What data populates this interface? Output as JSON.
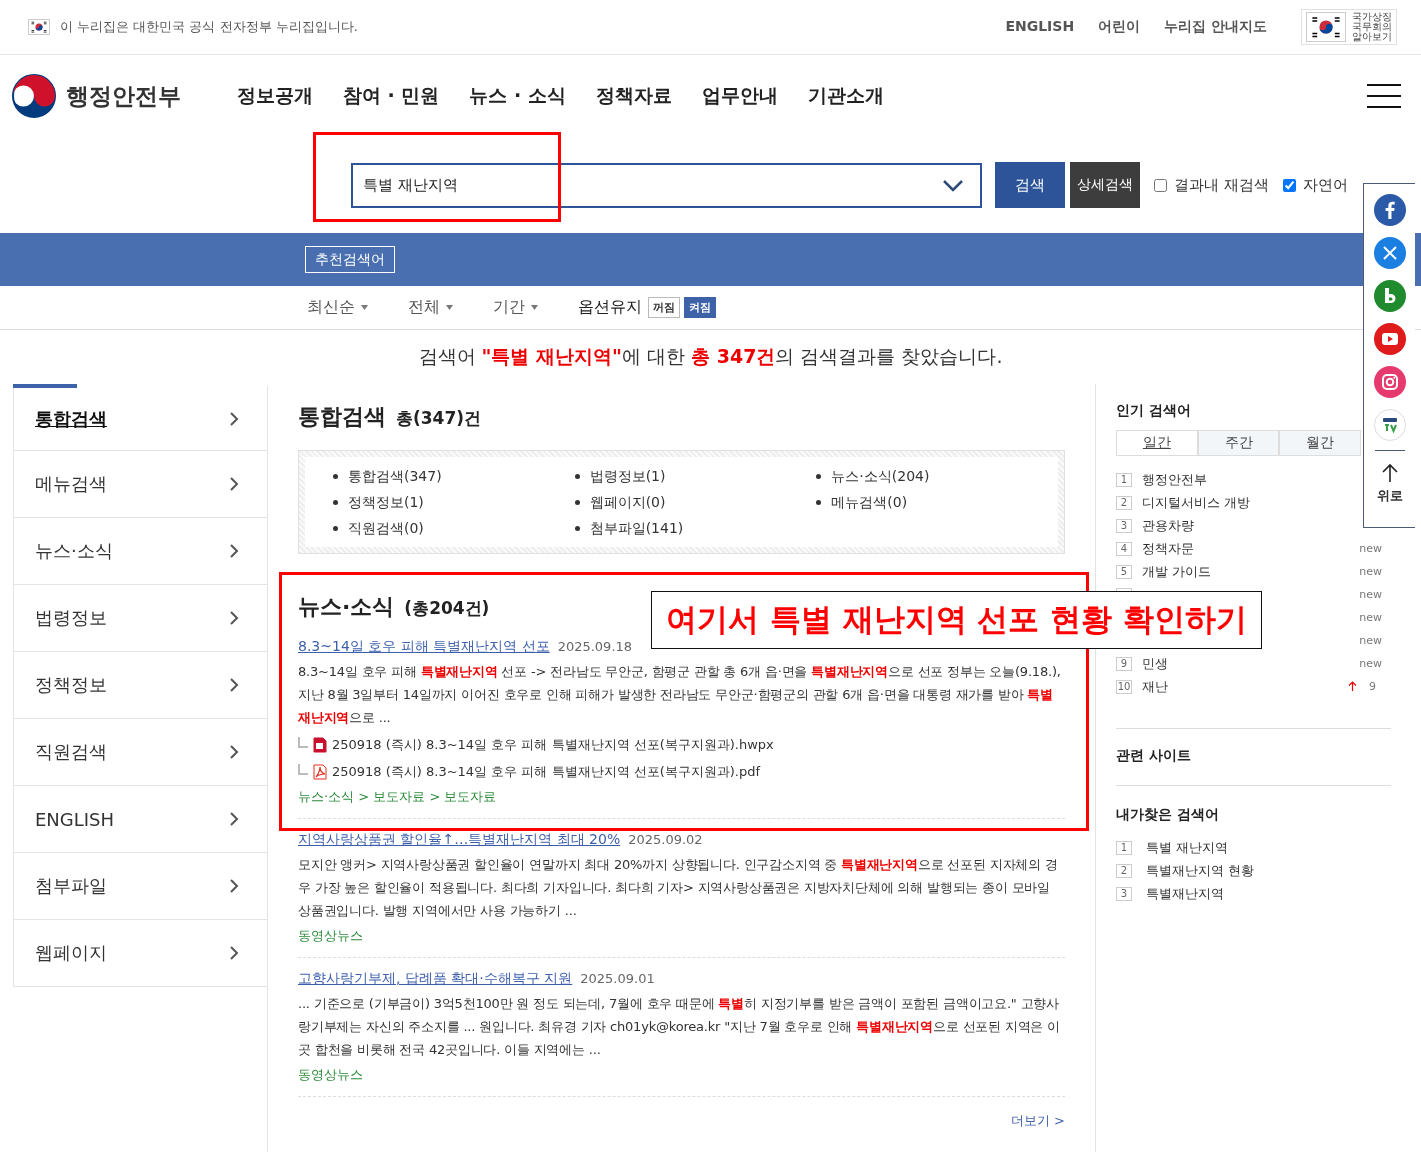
{
  "gov_banner": {
    "text": "이 누리집은 대한민국 공식 전자정부 누리집입니다."
  },
  "utility_links": [
    "ENGLISH",
    "어린이",
    "누리집 안내지도"
  ],
  "national_symbol": {
    "lines": [
      "국가상징",
      "국무회의",
      "알아보기"
    ]
  },
  "logo": {
    "text": "행정안전부"
  },
  "main_nav": [
    "정보공개",
    "참여 · 민원",
    "뉴스 · 소식",
    "정책자료",
    "업무안내",
    "기관소개"
  ],
  "search": {
    "value": "특별 재난지역",
    "buttons": [
      "검색",
      "상세검색"
    ],
    "options": [
      {
        "label": "결과내 재검색",
        "checked": false
      },
      {
        "label": "자연어",
        "checked": true
      }
    ]
  },
  "recommend_button": "추천검색어",
  "filters": [
    "최신순",
    "전체",
    "기간"
  ],
  "option_keep": {
    "label": "옵션유지",
    "toggles": [
      {
        "label": "꺼짐",
        "selected": false
      },
      {
        "label": "켜짐",
        "selected": true
      }
    ]
  },
  "summary": "검색어 **\"특별 재난지역\"**에 대한 **총 347건**의 검색결과를 찾았습니다.",
  "categories": [
    {
      "label": "통합검색",
      "selected": true
    },
    {
      "label": "메뉴검색",
      "selected": false
    },
    {
      "label": "뉴스·소식",
      "selected": false
    },
    {
      "label": "법령정보",
      "selected": false
    },
    {
      "label": "정책정보",
      "selected": false
    },
    {
      "label": "직원검색",
      "selected": false
    },
    {
      "label": "ENGLISH",
      "selected": false
    },
    {
      "label": "첨부파일",
      "selected": false
    },
    {
      "label": "웹페이지",
      "selected": false
    }
  ],
  "section_heading": {
    "title": "통합검색",
    "count": "총(347)건"
  },
  "category_counts": [
    "통합검색(347)",
    "법령정보(1)",
    "뉴스·소식(204)",
    "정책정보(1)",
    "웹페이지(0)",
    "메뉴검색(0)",
    "직원검색(0)",
    "첨부파일(141)"
  ],
  "news": {
    "title": "뉴스·소식",
    "count": "(총204건)",
    "results": [
      {
        "title": "8.3~14일 호우 피해 특별재난지역 선포",
        "date": "2025.09.18",
        "snippet": "8.3~14일 호우 피해 **특별재난지역** 선포 -> 전라남도 무안군, 함평군 관할 총 6개 읍·면을 **특별재난지역**으로 선포 정부는 오늘(9.18.), 지난 8월 3일부터 14일까지 이어진 호우로 인해 피해가 발생한 전라남도 무안군·함평군의 관할 6개 읍·면을 대통령 재가를 받아 **특별재난지역**으로 ...",
        "attachments": [
          {
            "kind": "hwp",
            "name": "250918 (즉시) 8.3~14일 호우 피해 특별재난지역 선포(복구지원과).hwpx"
          },
          {
            "kind": "pdf",
            "name": "250918 (즉시) 8.3~14일 호우 피해 특별재난지역 선포(복구지원과).pdf"
          }
        ],
        "path": "뉴스·소식 > 보도자료 > 보도자료"
      },
      {
        "title": "지역사랑상품권 할인율↑…특별재난지역 최대 20%",
        "date": "2025.09.02",
        "snippet": "모지안 앵커> 지역사랑상품권 할인율이 연말까지 최대 20%까지 상향됩니다. 인구감소지역 중 **특별재난지역**으로 선포된 지자체의 경우 가장 높은 할인율이 적용됩니다. 최다희 기자입니다. 최다희 기자> 지역사랑상품권은 지방자치단체에 의해 발행되는 종이 모바일 상품권입니다. 발행 지역에서만 사용 가능하기 ...",
        "path": "동영상뉴스"
      },
      {
        "title": "고향사랑기부제, 답례품 확대·수해복구 지원",
        "date": "2025.09.01",
        "snippet": "... 기준으로 (기부금이) 3억5천100만 원 정도 되는데, 7월에 호우 때문에 **특별**히 지정기부를 받은 금액이 포함된 금액이고요.\" 고향사랑기부제는 자신의 주소지를 ... 원입니다. 최유경 기자 ch01yk@korea.kr \"지난 7월 호우로 인해 **특별재난지역**으로 선포된 지역은 이곳 합천을 비롯해 전국 42곳입니다. 이들 지역에는 ...",
        "path": "동영상뉴스"
      }
    ],
    "more": "더보기 >"
  },
  "popular": {
    "title": "인기 검색어",
    "tabs": [
      {
        "label": "일간",
        "selected": true
      },
      {
        "label": "주간",
        "selected": false
      },
      {
        "label": "월간",
        "selected": false
      }
    ],
    "items": [
      {
        "rank": "1",
        "term": "행정안전부"
      },
      {
        "rank": "2",
        "term": "디지털서비스 개방"
      },
      {
        "rank": "3",
        "term": "관용차량"
      },
      {
        "rank": "4",
        "term": "정책자문",
        "badge": "new"
      },
      {
        "rank": "5",
        "term": "개발 가이드",
        "badge": "new"
      },
      {
        "badge": "new"
      },
      {
        "badge": "new"
      },
      {
        "badge": "new"
      },
      {
        "rank": "9",
        "term": "민생",
        "badge": "new"
      },
      {
        "rank": "10",
        "term": "재난",
        "change": {
          "kind": "up",
          "value": "9"
        }
      }
    ]
  },
  "related_sites": {
    "title": "관련 사이트"
  },
  "my_searches": {
    "title": "내가찾은 검색어",
    "items": [
      {
        "rank": "1",
        "term": "특별 재난지역"
      },
      {
        "rank": "2",
        "term": "특별재난지역 현황"
      },
      {
        "rank": "3",
        "term": "특별재난지역"
      }
    ]
  },
  "social_dock": {
    "icons": [
      {
        "kind": "facebook"
      },
      {
        "kind": "x"
      },
      {
        "kind": "blog"
      },
      {
        "kind": "youtube"
      },
      {
        "kind": "instagram"
      },
      {
        "kind": "tv"
      }
    ],
    "top_label": "위로"
  },
  "annotation": {
    "text": "여기서 특별 재난지역 선포 현황 확인하기"
  }
}
